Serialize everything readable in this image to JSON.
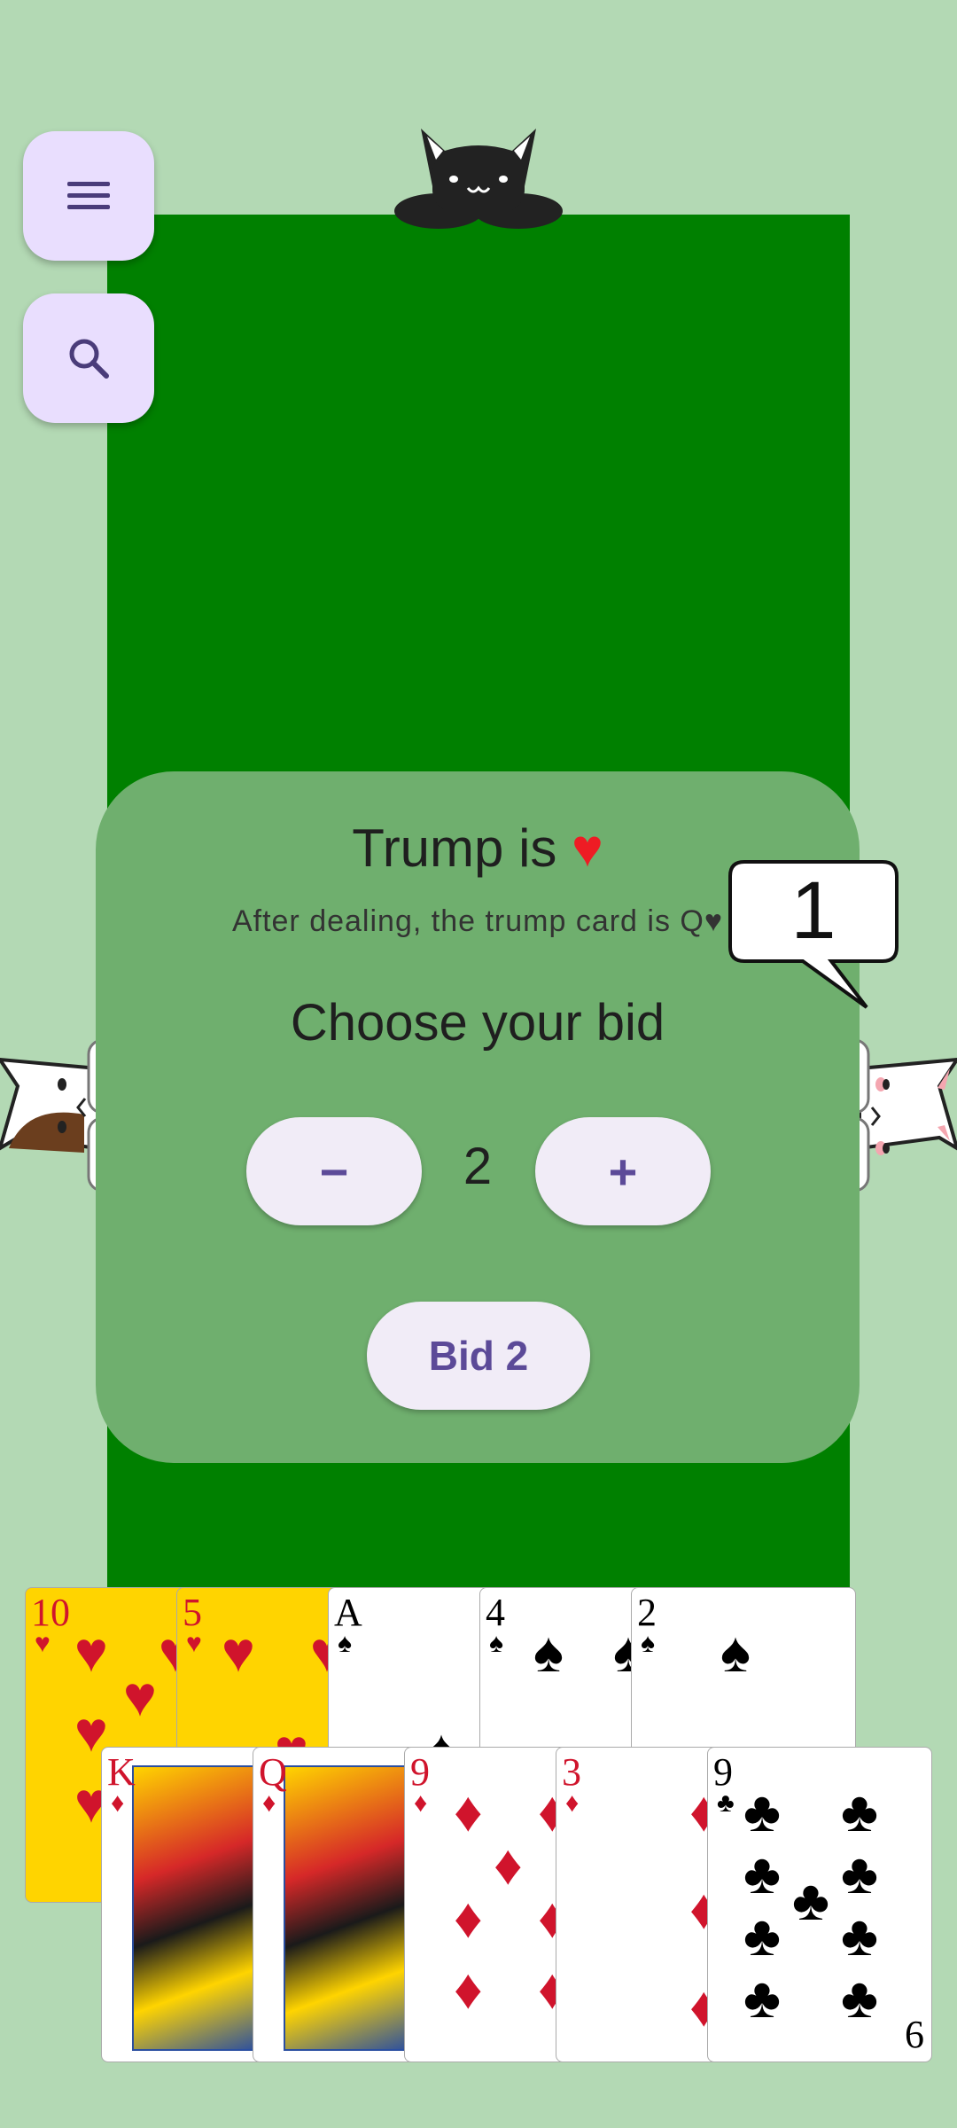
{
  "bid_panel": {
    "trump_text": "Trump is",
    "trump_suit_glyph": "♥",
    "trump_subtitle": "After dealing, the trump card is Q♥",
    "choose_text": "Choose your bid",
    "minus_label": "−",
    "plus_label": "+",
    "bid_value": "2",
    "bid_button_label": "Bid 2"
  },
  "speech_bubble": {
    "text": "1"
  },
  "icons": {
    "menu": "menu-icon",
    "search": "search-icon"
  },
  "colors": {
    "felt": "#008000",
    "background": "#b3d9b4",
    "highlight_card": "#ffd400",
    "accent": "#5c4a98"
  },
  "hand": {
    "back_row": [
      {
        "rank": "10",
        "suit": "♥",
        "color": "red",
        "highlighted": true
      },
      {
        "rank": "5",
        "suit": "♥",
        "color": "red",
        "highlighted": true
      },
      {
        "rank": "A",
        "suit": "♠",
        "color": "black",
        "highlighted": false
      },
      {
        "rank": "4",
        "suit": "♠",
        "color": "black",
        "highlighted": false
      },
      {
        "rank": "2",
        "suit": "♠",
        "color": "black",
        "highlighted": false
      }
    ],
    "front_row": [
      {
        "rank": "K",
        "suit": "♦",
        "color": "red",
        "highlighted": false
      },
      {
        "rank": "Q",
        "suit": "♦",
        "color": "red",
        "highlighted": false
      },
      {
        "rank": "9",
        "suit": "♦",
        "color": "red",
        "highlighted": false
      },
      {
        "rank": "3",
        "suit": "♦",
        "color": "red",
        "highlighted": false
      },
      {
        "rank": "9",
        "suit": "♣",
        "color": "black",
        "highlighted": false,
        "bottom_rank": "6"
      }
    ]
  }
}
